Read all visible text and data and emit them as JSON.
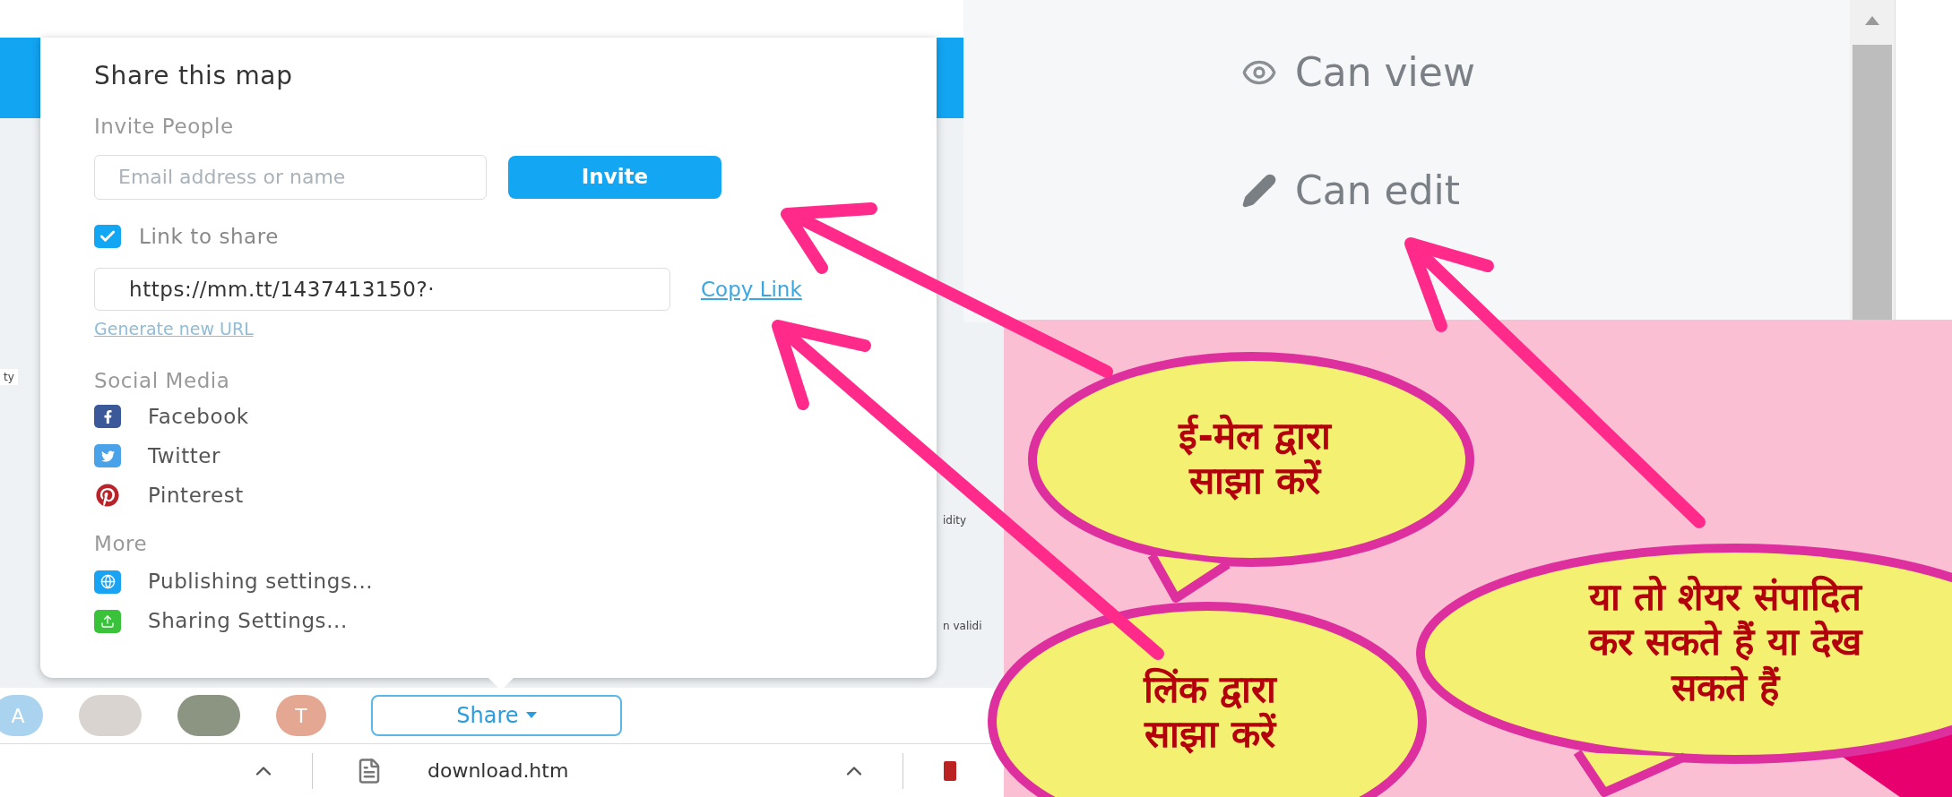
{
  "share_popup": {
    "title": "Share this map",
    "invite": {
      "label": "Invite People",
      "placeholder": "Email address or name",
      "button": "Invite"
    },
    "link": {
      "label": "Link to share",
      "checked": true,
      "url": "https://mm.tt/1437413150?·",
      "copy": "Copy Link",
      "generate": "Generate new URL"
    },
    "social": {
      "heading": "Social Media",
      "items": [
        {
          "kind": "facebook",
          "label": "Facebook"
        },
        {
          "kind": "twitter",
          "label": "Twitter"
        },
        {
          "kind": "pinterest",
          "label": "Pinterest"
        }
      ]
    },
    "more": {
      "heading": "More",
      "items": [
        {
          "kind": "publishing",
          "label": "Publishing settings..."
        },
        {
          "kind": "sharing",
          "label": "Sharing Settings..."
        }
      ]
    }
  },
  "background_fragments": [
    "ty",
    "idity",
    "n validi"
  ],
  "collaborators": [
    {
      "kind": "letter",
      "text": "A",
      "color": "#a9d3ee"
    },
    {
      "kind": "photo",
      "color": "#d9d4cf"
    },
    {
      "kind": "photo",
      "color": "#8c9582"
    },
    {
      "kind": "letter",
      "text": "T",
      "color": "#e4a892"
    }
  ],
  "share_button": "Share",
  "download_bar": {
    "file": "download.htm"
  },
  "permissions": [
    {
      "kind": "view",
      "label": "Can view"
    },
    {
      "kind": "edit",
      "label": "Can edit"
    }
  ],
  "callouts": [
    {
      "lines": [
        "ई-मेल द्वारा",
        "साझा करें"
      ]
    },
    {
      "lines": [
        "लिंक द्वारा",
        "साझा करें"
      ]
    },
    {
      "lines": [
        "या तो शेयर संपादित",
        "कर सकते हैं या देख",
        "सकते हैं"
      ]
    }
  ]
}
